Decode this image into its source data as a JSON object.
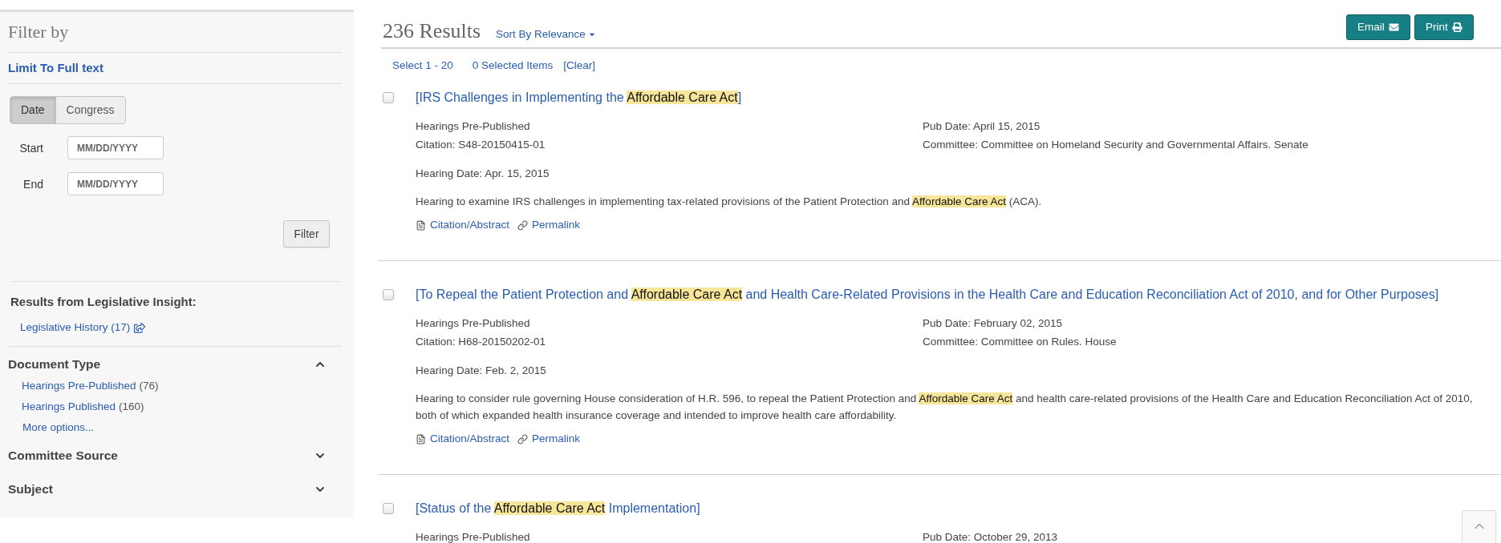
{
  "sidebar": {
    "title": "Filter by",
    "limit_link": "Limit To Full text",
    "filter_tabs": [
      {
        "label": "Date",
        "selected": true
      },
      {
        "label": "Congress",
        "selected": false
      }
    ],
    "date_fields": [
      {
        "label": "Start",
        "placeholder": "MM/DD/YYYY"
      },
      {
        "label": "End",
        "placeholder": "MM/DD/YYYY"
      }
    ],
    "filter_button": "Filter",
    "insight": {
      "heading": "Results from Legislative Insight:",
      "link": "Legislative History (17)"
    },
    "facets": [
      {
        "title": "Document Type",
        "expanded": true,
        "options": [
          {
            "label": "Hearings Pre-Published",
            "count": "(76)"
          },
          {
            "label": "Hearings Published",
            "count": "(160)"
          }
        ],
        "more": "More options..."
      },
      {
        "title": "Committee Source",
        "expanded": false
      },
      {
        "title": "Subject",
        "expanded": false
      }
    ]
  },
  "results_header": {
    "count": "236 Results",
    "sort": "Sort By Relevance",
    "buttons": [
      {
        "label": "Email",
        "kind": "email"
      },
      {
        "label": "Print",
        "kind": "print"
      }
    ]
  },
  "selection_bar": [
    "Select 1 - 20",
    "0 Selected Items",
    "[Clear]"
  ],
  "results": [
    {
      "checked": false,
      "title": [
        {
          "text": "[IRS Challenges in Implementing the ",
          "highlight": false
        },
        {
          "text": "Affordable Care Act",
          "highlight": true
        },
        {
          "text": "]",
          "highlight": false
        }
      ],
      "doc_type": "Hearings Pre-Published",
      "citation": "Citation: S48-20150415-01",
      "pub_date": "Pub Date: April 15, 2015",
      "committee": "Committee: Committee on Homeland Security and Governmental Affairs. Senate",
      "hearing_date": "Hearing Date: Apr. 15, 2015",
      "description": [
        {
          "text": "Hearing to examine IRS challenges in implementing tax-related provisions of the Patient Protection and ",
          "highlight": false
        },
        {
          "text": "Affordable Care Act",
          "highlight": true
        },
        {
          "text": " (ACA).",
          "highlight": false
        }
      ],
      "links": [
        {
          "label": "Citation/Abstract",
          "kind": "abstract"
        },
        {
          "label": "Permalink",
          "kind": "permalink"
        }
      ]
    },
    {
      "checked": false,
      "title": [
        {
          "text": "[To Repeal the Patient Protection and ",
          "highlight": false
        },
        {
          "text": "Affordable Care Act",
          "highlight": true
        },
        {
          "text": " and Health Care-Related Provisions in the Health Care and Education Reconciliation Act of 2010, and for Other Purposes]",
          "highlight": false
        }
      ],
      "doc_type": "Hearings Pre-Published",
      "citation": "Citation: H68-20150202-01",
      "pub_date": "Pub Date: February 02, 2015",
      "committee": "Committee: Committee on Rules. House",
      "hearing_date": "Hearing Date: Feb. 2, 2015",
      "description": [
        {
          "text": "Hearing to consider rule governing House consideration of H.R. 596, to repeal the Patient Protection and ",
          "highlight": false
        },
        {
          "text": "Affordable Care Act",
          "highlight": true
        },
        {
          "text": " and health care-related provisions of the Health Care and Education Reconciliation Act of 2010, both of which expanded health insurance coverage and intended to improve health care affordability.",
          "highlight": false
        }
      ],
      "links": [
        {
          "label": "Citation/Abstract",
          "kind": "abstract"
        },
        {
          "label": "Permalink",
          "kind": "permalink"
        }
      ]
    },
    {
      "checked": false,
      "title": [
        {
          "text": "[Status of the ",
          "highlight": false
        },
        {
          "text": "Affordable Care Act",
          "highlight": true
        },
        {
          "text": " Implementation]",
          "highlight": false
        }
      ],
      "doc_type": "Hearings Pre-Published",
      "pub_date": "Pub Date: October 29, 2013"
    }
  ]
}
